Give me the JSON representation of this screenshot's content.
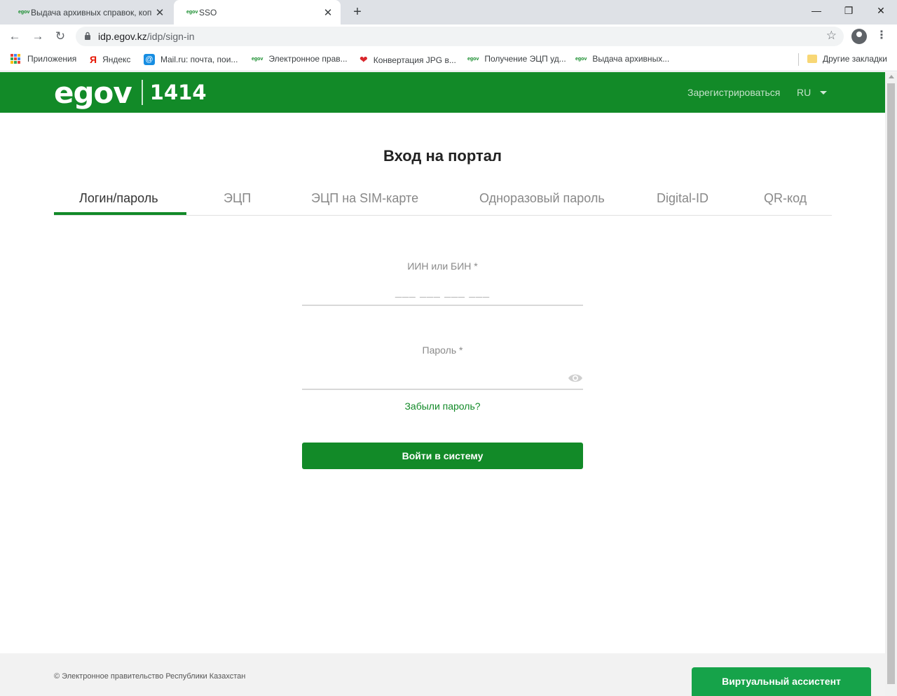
{
  "browser": {
    "tabs": [
      {
        "favicon": "egov",
        "title": "Выдача архивных справок, коп",
        "close": "✕"
      },
      {
        "favicon": "egov",
        "title": "SSO",
        "close": "✕"
      }
    ],
    "new_tab": "+",
    "window_controls": {
      "minimize": "—",
      "restore": "❐",
      "close": "✕"
    },
    "nav": {
      "back": "←",
      "forward": "→",
      "reload": "↻"
    },
    "url_host": "idp.egov.kz",
    "url_path": "/idp/sign-in",
    "bookmark_star": "☆",
    "menu": "⋮",
    "bookmarks": [
      {
        "icon": "apps-grid-icon",
        "label": "Приложения"
      },
      {
        "icon": "Я",
        "label": "Яндекс"
      },
      {
        "icon": "@",
        "label": "Mail.ru: почта, пои..."
      },
      {
        "icon": "egov",
        "label": "Электронное прав..."
      },
      {
        "icon": "❤",
        "label": "Конвертация JPG в..."
      },
      {
        "icon": "egov",
        "label": "Получение ЭЦП уд..."
      },
      {
        "icon": "egov",
        "label": "Выдача архивных..."
      }
    ],
    "other_bookmarks": "Другие закладки"
  },
  "header": {
    "logo_text": "egov",
    "logo_number": "1414",
    "register": "Зарегистрироваться",
    "lang": "RU"
  },
  "main": {
    "title": "Вход на портал",
    "tabs": [
      {
        "label": "Логин/пароль",
        "active": true
      },
      {
        "label": "ЭЦП",
        "active": false
      },
      {
        "label": "ЭЦП на SIM-карте",
        "active": false
      },
      {
        "label": "Одноразовый пароль",
        "active": false
      },
      {
        "label": "Digital-ID",
        "active": false
      },
      {
        "label": "QR-код",
        "active": false
      }
    ],
    "iin_label": "ИИН или БИН *",
    "iin_placeholder": "___ ___ ___ ___",
    "password_label": "Пароль *",
    "password_value": "",
    "forgot": "Забыли пароль?",
    "login_button": "Войти в систему"
  },
  "footer": {
    "copyright": "© Электронное правительство Республики Казахстан",
    "assistant": "Виртуальный ассистент"
  },
  "colors": {
    "brand_green": "#128a28",
    "assistant_green": "#16a34a"
  }
}
